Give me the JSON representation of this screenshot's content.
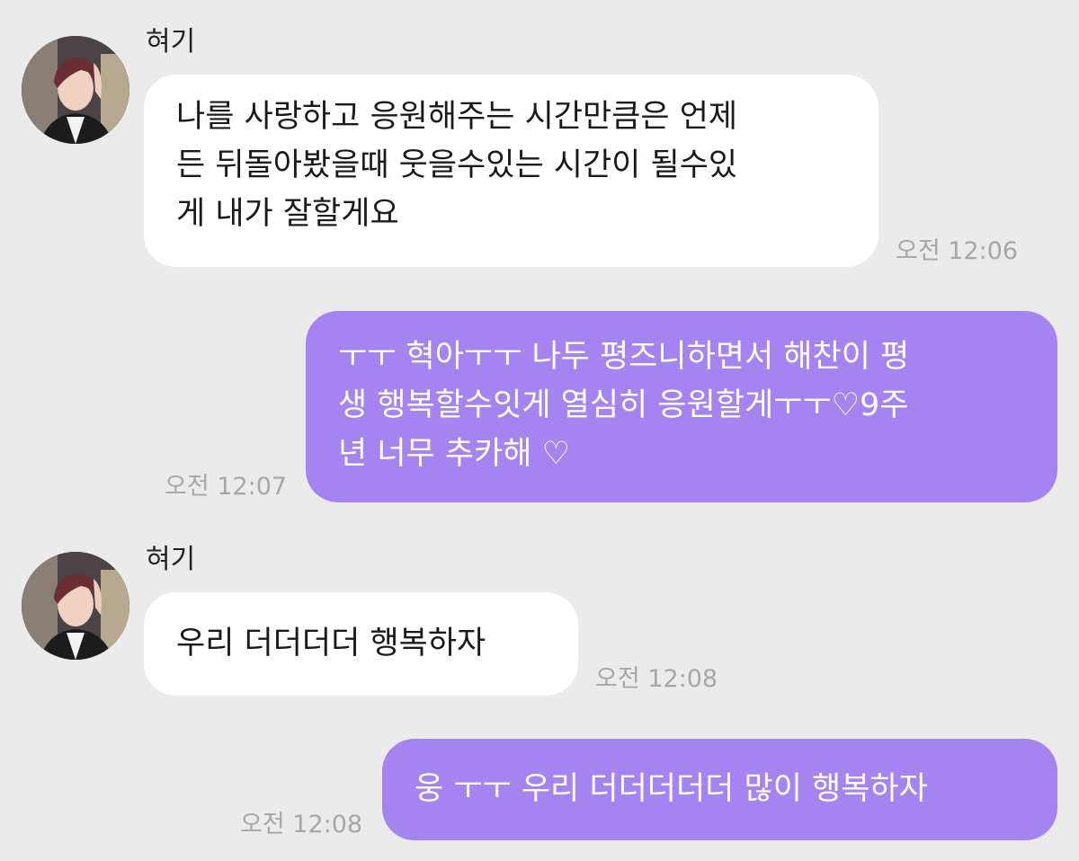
{
  "colors": {
    "background": "#ebebeb",
    "incoming_bubble": "#ffffff",
    "outgoing_bubble": "#a384f0",
    "timestamp": "#a7a7a7"
  },
  "messages": [
    {
      "direction": "incoming",
      "sender": "혀기",
      "avatar": "profile-photo",
      "lines": [
        "나를 사랑하고 응원해주는 시간만큼은 언제",
        "든 뒤돌아봤을때 웃을수있는 시간이 될수있",
        "게 내가 잘할게요"
      ],
      "time": "오전 12:06"
    },
    {
      "direction": "outgoing",
      "lines": [
        "ㅜㅜ 혁아ㅜㅜ 나두 평즈니하면서 해찬이 평",
        "생 행복할수잇게 열심히 응원할게ㅜㅜ♡9주",
        "년 너무 추카해 ♡"
      ],
      "time": "오전 12:07"
    },
    {
      "direction": "incoming",
      "sender": "혀기",
      "avatar": "profile-photo",
      "lines": [
        "우리 더더더더 행복하자"
      ],
      "time": "오전 12:08"
    },
    {
      "direction": "outgoing",
      "lines": [
        "웅 ㅜㅜ 우리 더더더더더 많이 행복하자"
      ],
      "time": "오전 12:08"
    }
  ]
}
